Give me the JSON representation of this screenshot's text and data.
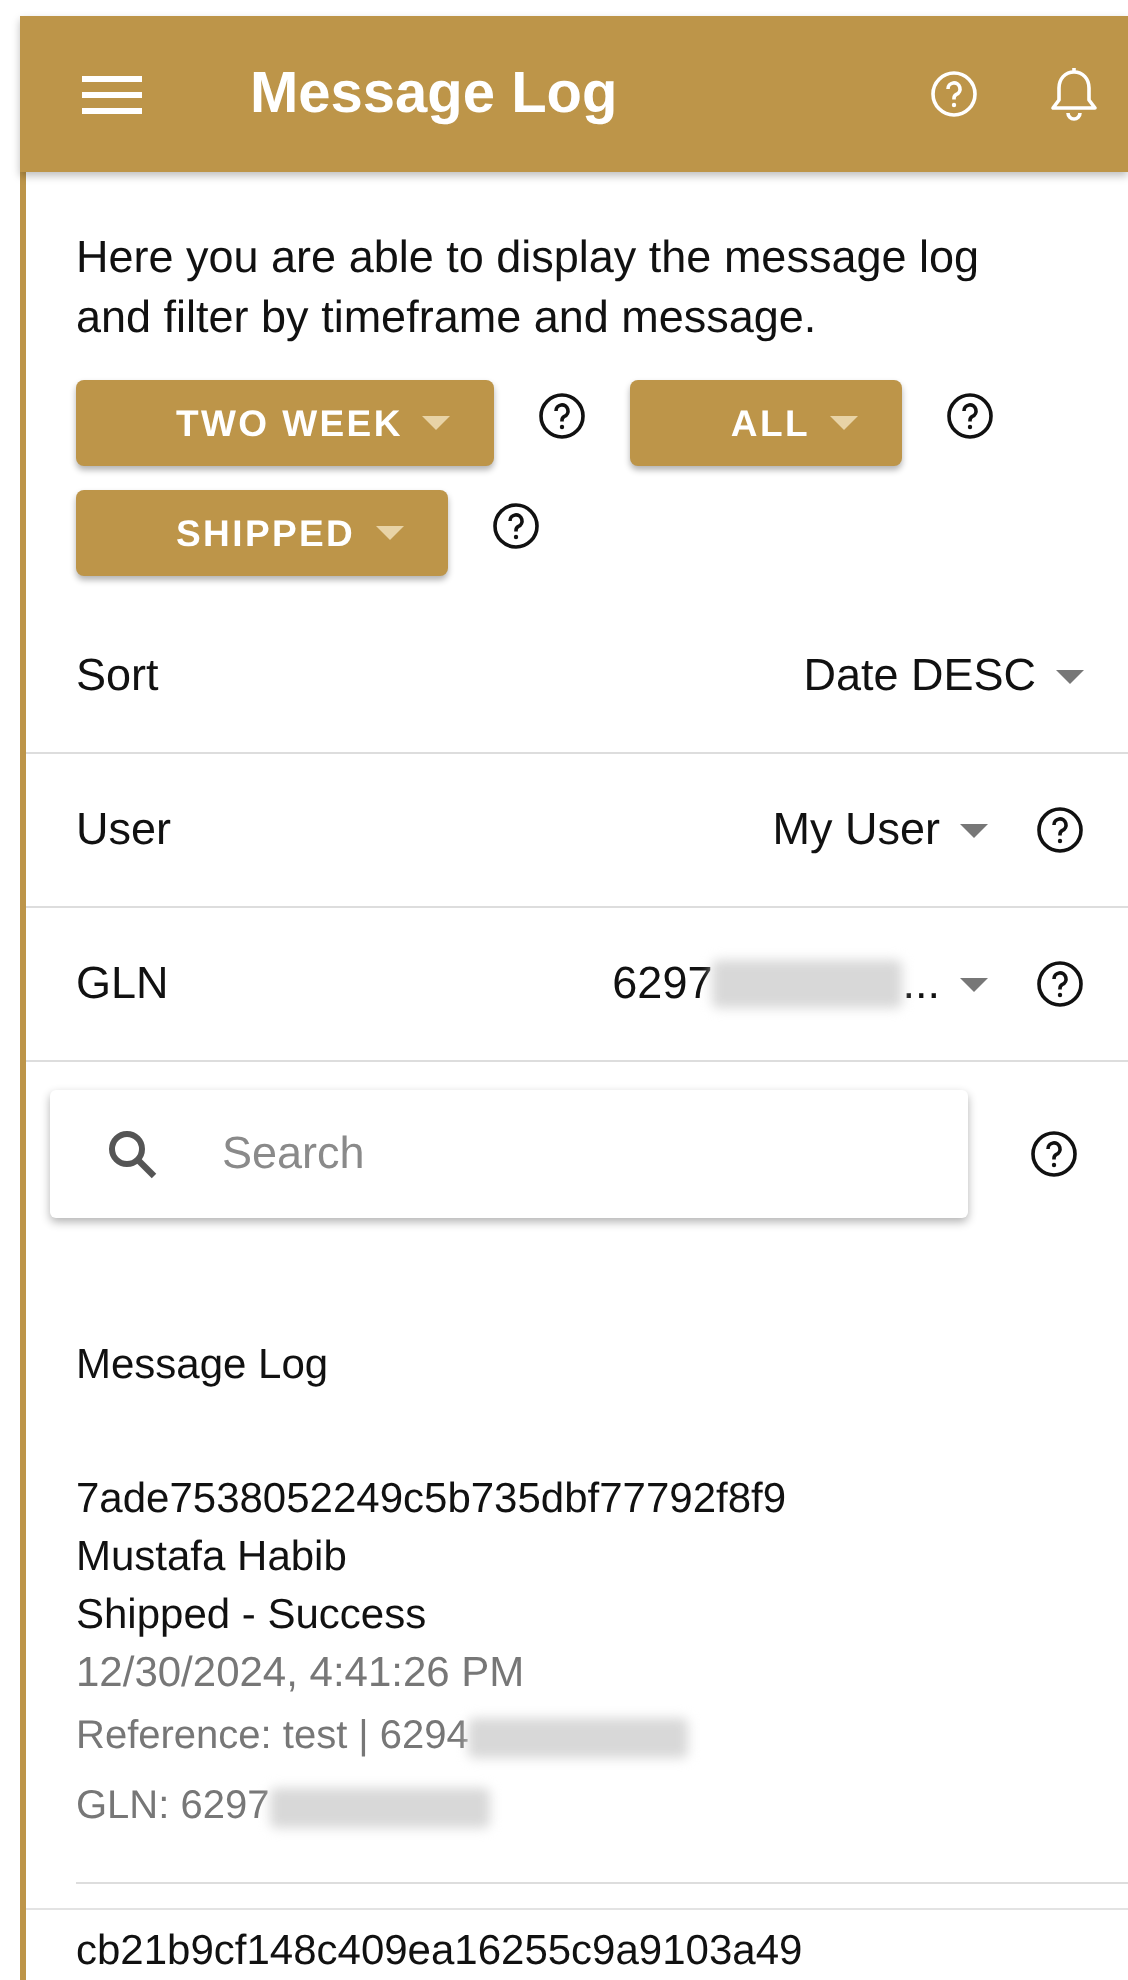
{
  "app_bar": {
    "title": "Message Log"
  },
  "description": "Here you are able to display the message log and filter by timeframe and message.",
  "filters": [
    {
      "label": "TWO WEEK"
    },
    {
      "label": "ALL"
    },
    {
      "label": "SHIPPED"
    }
  ],
  "settings": [
    {
      "label": "Sort",
      "value": "Date DESC",
      "redacted": false,
      "help": false
    },
    {
      "label": "User",
      "value": "My User",
      "redacted": false,
      "help": true
    },
    {
      "label": "GLN",
      "value": "6297",
      "redacted": true,
      "ellipsis": "...",
      "help": true
    }
  ],
  "search": {
    "placeholder": "Search"
  },
  "log_title": "Message Log",
  "entries": [
    {
      "id": "7ade7538052249c5b735dbf77792f8f9",
      "user": "Mustafa Habib",
      "status": "Shipped - Success",
      "time": "12/30/2024, 4:41:26 PM",
      "reference": "Reference: test | 6294",
      "reference_redacted": true,
      "gln": "GLN: 6297",
      "gln_redacted": true
    },
    {
      "id": "cb21b9cf148c409ea16255c9a9103a49"
    }
  ]
}
